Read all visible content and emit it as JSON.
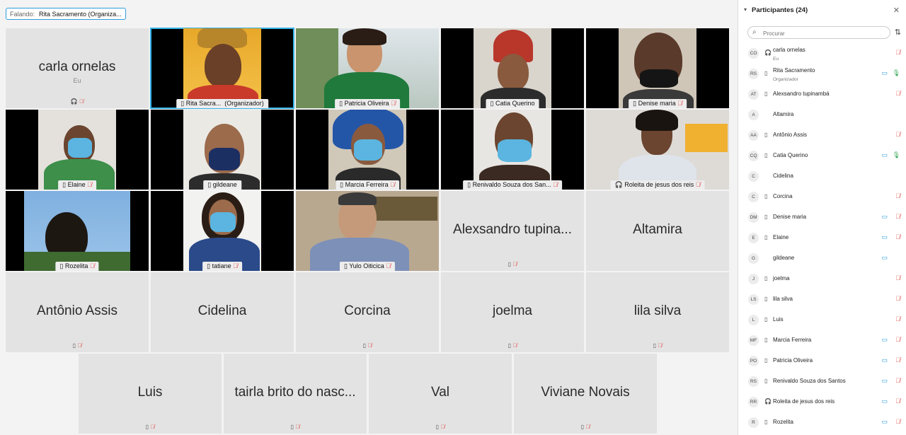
{
  "speaker": {
    "label": "Falando:",
    "name": "Rita Sacramento (Organiza..."
  },
  "tiles": {
    "carla": {
      "name": "carla ornelas",
      "sub": "Eu"
    },
    "rita": {
      "tag_name": "Rita Sacra...",
      "tag_role": "(Organizador)"
    },
    "patricia": {
      "tag": "Patricia Oliveira"
    },
    "catia": {
      "tag": "Catia Querino"
    },
    "denise": {
      "tag": "Denise maria"
    },
    "elaine": {
      "tag": "Elaine"
    },
    "gildeane": {
      "tag": "gildeane"
    },
    "marcia": {
      "tag": "Marcia Ferreira"
    },
    "renivaldo": {
      "tag": "Renivaldo Souza dos San..."
    },
    "roleita": {
      "tag": "Roleita de jesus dos reis"
    },
    "rozelita": {
      "tag": "Rozelita"
    },
    "tatiane": {
      "tag": "tatiane"
    },
    "yulo": {
      "tag": "Yulo Oiticica"
    },
    "alexsandro": {
      "name": "Alexsandro tupina..."
    },
    "altamira": {
      "name": "Altamira"
    },
    "antonio": {
      "name": "Antônio Assis"
    },
    "cidelina": {
      "name": "Cidelina"
    },
    "corcina": {
      "name": "Corcina"
    },
    "joelma": {
      "name": "joelma"
    },
    "lila": {
      "name": "lila silva"
    },
    "luis": {
      "name": "Luis"
    },
    "tairla": {
      "name": "tairla brito do nasc..."
    },
    "val": {
      "name": "Val"
    },
    "viviane": {
      "name": "Viviane Novais"
    }
  },
  "panel": {
    "title": "Participantes (24)",
    "search_placeholder": "Procurar",
    "participants": [
      {
        "initials": "CO",
        "name": "carla ornelas",
        "role": "Eu",
        "device": "headset",
        "camera": false,
        "mic": "muted"
      },
      {
        "initials": "RS",
        "name": "Rita Sacramento",
        "role": "Organizador",
        "device": "phone",
        "camera": true,
        "mic": "on"
      },
      {
        "initials": "AT",
        "name": "Alexsandro tupinambá",
        "role": "",
        "device": "phone",
        "camera": false,
        "mic": "muted"
      },
      {
        "initials": "A",
        "name": "Altamira",
        "role": "",
        "device": "",
        "camera": false,
        "mic": "none"
      },
      {
        "initials": "AA",
        "name": "Antônio Assis",
        "role": "",
        "device": "phone",
        "camera": false,
        "mic": "muted"
      },
      {
        "initials": "CQ",
        "name": "Catia Querino",
        "role": "",
        "device": "phone",
        "camera": true,
        "mic": "on"
      },
      {
        "initials": "C",
        "name": "Cidelina",
        "role": "",
        "device": "",
        "camera": false,
        "mic": "none"
      },
      {
        "initials": "C",
        "name": "Corcina",
        "role": "",
        "device": "phone",
        "camera": false,
        "mic": "muted"
      },
      {
        "initials": "DM",
        "name": "Denise maria",
        "role": "",
        "device": "phone",
        "camera": true,
        "mic": "muted"
      },
      {
        "initials": "E",
        "name": "Elaine",
        "role": "",
        "device": "phone",
        "camera": true,
        "mic": "muted"
      },
      {
        "initials": "G",
        "name": "gildeane",
        "role": "",
        "device": "",
        "camera": true,
        "mic": "none"
      },
      {
        "initials": "J",
        "name": "joelma",
        "role": "",
        "device": "phone",
        "camera": false,
        "mic": "muted"
      },
      {
        "initials": "LS",
        "name": "lila silva",
        "role": "",
        "device": "phone",
        "camera": false,
        "mic": "muted"
      },
      {
        "initials": "L",
        "name": "Luis",
        "role": "",
        "device": "phone",
        "camera": false,
        "mic": "muted"
      },
      {
        "initials": "MF",
        "name": "Marcia Ferreira",
        "role": "",
        "device": "phone",
        "camera": true,
        "mic": "muted"
      },
      {
        "initials": "PO",
        "name": "Patricia Oliveira",
        "role": "",
        "device": "phone",
        "camera": true,
        "mic": "muted"
      },
      {
        "initials": "RS",
        "name": "Renivaldo Souza dos Santos",
        "role": "",
        "device": "phone",
        "camera": true,
        "mic": "muted"
      },
      {
        "initials": "RR",
        "name": "Roleita de jesus dos reis",
        "role": "",
        "device": "headset",
        "camera": true,
        "mic": "muted"
      },
      {
        "initials": "R",
        "name": "Rozelita",
        "role": "",
        "device": "phone",
        "camera": true,
        "mic": "muted"
      }
    ]
  }
}
